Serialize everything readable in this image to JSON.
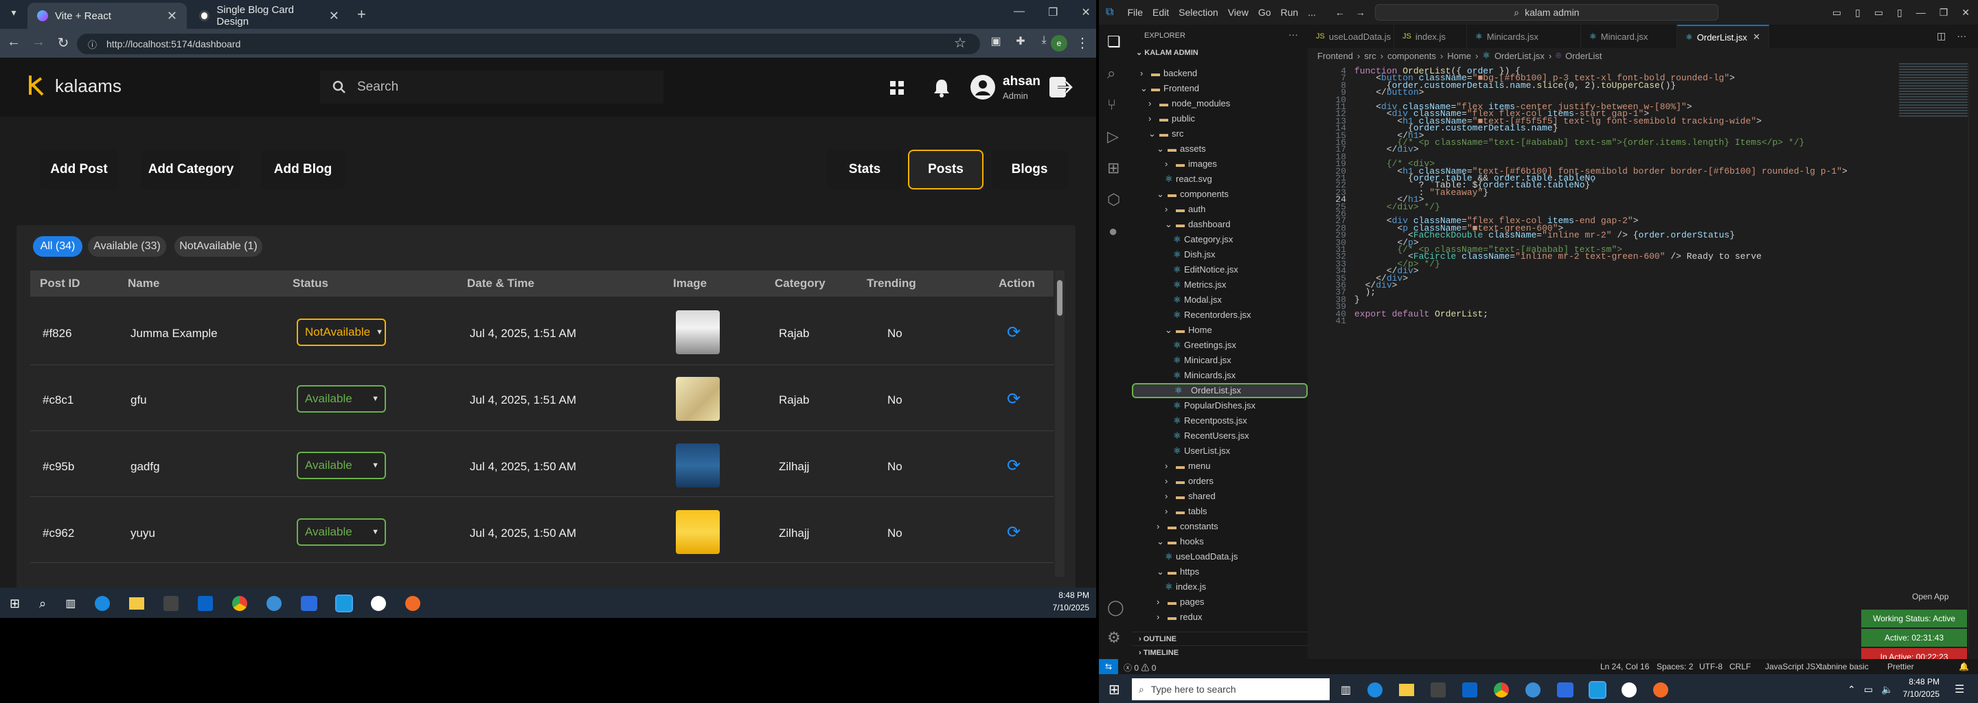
{
  "browser": {
    "tabs": [
      {
        "title": "Vite + React"
      },
      {
        "title": "Single Blog Card Design"
      }
    ],
    "url": "http://localhost:5174/dashboard"
  },
  "app": {
    "logo": "kalaams",
    "search_placeholder": "Search",
    "user": {
      "name": "ahsan",
      "role": "Admin"
    },
    "left_nav": [
      "Add Post",
      "Add Category",
      "Add Blog"
    ],
    "right_nav": [
      "Stats",
      "Posts",
      "Blogs"
    ],
    "active_nav": "Posts",
    "filters": [
      "All (34)",
      "Available (33)",
      "NotAvailable (1)"
    ],
    "columns": [
      "Post ID",
      "Name",
      "Status",
      "Date & Time",
      "Image",
      "Category",
      "Trending",
      "Action"
    ],
    "rows": [
      {
        "id": "#f826",
        "name": "Jumma Example",
        "status": "NotAvailable",
        "date": "Jul 4, 2025, 1:51 AM",
        "category": "Rajab",
        "trending": "No"
      },
      {
        "id": "#c8c1",
        "name": "gfu",
        "status": "Available",
        "date": "Jul 4, 2025, 1:51 AM",
        "category": "Rajab",
        "trending": "No"
      },
      {
        "id": "#c95b",
        "name": "gadfg",
        "status": "Available",
        "date": "Jul 4, 2025, 1:50 AM",
        "category": "Zilhajj",
        "trending": "No"
      },
      {
        "id": "#c962",
        "name": "yuyu",
        "status": "Available",
        "date": "Jul 4, 2025, 1:50 AM",
        "category": "Zilhajj",
        "trending": "No"
      }
    ],
    "colors": {
      "accent": "#f6b100",
      "available": "#6ab04c",
      "not_available": "#f6b100",
      "filter_active": "#1e7ee8",
      "refresh": "#1e90ff"
    }
  },
  "taskbar_left": {
    "time": "8:48 PM",
    "date": "7/10/2025"
  },
  "vscode": {
    "menu": [
      "File",
      "Edit",
      "Selection",
      "View",
      "Go",
      "Run",
      "..."
    ],
    "search": "kalam admin",
    "explorer_title": "EXPLORER",
    "workspace": "KALAM ADMIN",
    "tree": [
      {
        "label": "backend",
        "depth": 0,
        "kind": "folder",
        "open": false
      },
      {
        "label": "Frontend",
        "depth": 0,
        "kind": "folder",
        "open": true
      },
      {
        "label": "node_modules",
        "depth": 1,
        "kind": "folder",
        "open": false
      },
      {
        "label": "public",
        "depth": 1,
        "kind": "folder",
        "open": false
      },
      {
        "label": "src",
        "depth": 1,
        "kind": "folder",
        "open": true
      },
      {
        "label": "assets",
        "depth": 2,
        "kind": "folder",
        "open": true
      },
      {
        "label": "images",
        "depth": 3,
        "kind": "folder",
        "open": false
      },
      {
        "label": "react.svg",
        "depth": 3,
        "kind": "file",
        "open": false
      },
      {
        "label": "components",
        "depth": 2,
        "kind": "folder",
        "open": true
      },
      {
        "label": "auth",
        "depth": 3,
        "kind": "folder",
        "open": false
      },
      {
        "label": "dashboard",
        "depth": 3,
        "kind": "folder",
        "open": true
      },
      {
        "label": "Category.jsx",
        "depth": 4,
        "kind": "file",
        "open": false
      },
      {
        "label": "Dish.jsx",
        "depth": 4,
        "kind": "file",
        "open": false
      },
      {
        "label": "EditNotice.jsx",
        "depth": 4,
        "kind": "file",
        "open": false
      },
      {
        "label": "Metrics.jsx",
        "depth": 4,
        "kind": "file",
        "open": false
      },
      {
        "label": "Modal.jsx",
        "depth": 4,
        "kind": "file",
        "open": false
      },
      {
        "label": "Recentorders.jsx",
        "depth": 4,
        "kind": "file",
        "open": false
      },
      {
        "label": "Home",
        "depth": 3,
        "kind": "folder",
        "open": true
      },
      {
        "label": "Greetings.jsx",
        "depth": 4,
        "kind": "file",
        "open": false
      },
      {
        "label": "Minicard.jsx",
        "depth": 4,
        "kind": "file",
        "open": false
      },
      {
        "label": "Minicards.jsx",
        "depth": 4,
        "kind": "file",
        "open": false
      },
      {
        "label": "OrderList.jsx",
        "depth": 4,
        "kind": "file",
        "open": false
      },
      {
        "label": "PopularDishes.jsx",
        "depth": 4,
        "kind": "file",
        "open": false
      },
      {
        "label": "Recentposts.jsx",
        "depth": 4,
        "kind": "file",
        "open": false
      },
      {
        "label": "RecentUsers.jsx",
        "depth": 4,
        "kind": "file",
        "open": false
      },
      {
        "label": "UserList.jsx",
        "depth": 4,
        "kind": "file",
        "open": false
      },
      {
        "label": "menu",
        "depth": 3,
        "kind": "folder",
        "open": false
      },
      {
        "label": "orders",
        "depth": 3,
        "kind": "folder",
        "open": false
      },
      {
        "label": "shared",
        "depth": 3,
        "kind": "folder",
        "open": false
      },
      {
        "label": "tabls",
        "depth": 3,
        "kind": "folder",
        "open": false
      },
      {
        "label": "constants",
        "depth": 2,
        "kind": "folder",
        "open": false
      },
      {
        "label": "hooks",
        "depth": 2,
        "kind": "folder",
        "open": true
      },
      {
        "label": "useLoadData.js",
        "depth": 3,
        "kind": "file",
        "open": false
      },
      {
        "label": "https",
        "depth": 2,
        "kind": "folder",
        "open": true
      },
      {
        "label": "index.js",
        "depth": 3,
        "kind": "file",
        "open": false
      },
      {
        "label": "pages",
        "depth": 2,
        "kind": "folder",
        "open": false
      },
      {
        "label": "redux",
        "depth": 2,
        "kind": "folder",
        "open": false
      }
    ],
    "selected_file": "OrderList.jsx",
    "outline": "OUTLINE",
    "timeline": "TIMELINE",
    "tabs": [
      "useLoadData.js",
      "index.js",
      "Minicards.jsx",
      "Minicard.jsx",
      "OrderList.jsx"
    ],
    "active_tab": "OrderList.jsx",
    "breadcrumb": [
      "Frontend",
      "src",
      "components",
      "Home",
      "OrderList.jsx",
      "OrderList"
    ],
    "line_numbers": [
      "4",
      "7",
      "8",
      "9",
      "10",
      "11",
      "12",
      "13",
      "14",
      "15",
      "16",
      "17",
      "18",
      "19",
      "20",
      "21",
      "22",
      "23",
      "24",
      "25",
      "26",
      "27",
      "28",
      "29",
      "30",
      "31",
      "32",
      "33",
      "34",
      "35",
      "36",
      "37",
      "38",
      "39",
      "40",
      "41"
    ],
    "code_lines": [
      "function OrderList({ order }) {",
      "    <button className=\"■bg-[#f6b100] p-3 text-xl font-bold rounded-lg\">",
      "      {order.customerDetails.name.slice(0, 2).toUpperCase()}",
      "    </button>",
      "",
      "    <div className=\"flex items-center justify-between w-[80%]\">",
      "      <div className=\"flex flex-col items-start gap-1\">",
      "        <h1 className=\"■text-[#f5f5f5] text-lg font-semibold tracking-wide\">",
      "          {order.customerDetails.name}",
      "        </h1>",
      "        {/* <p className=\"text-[#ababab] text-sm\">{order.items.length} Items</p> */}",
      "      </div>",
      "",
      "      {/* <div>",
      "        <h1 className=\"text-[#f6b100] font-semibold border border-[#f6b100] rounded-lg p-1\">",
      "          {order.table && order.table.tableNo",
      "            ? `Table: ${order.table.tableNo}`",
      "            : \"Takeaway\"}",
      "        </h1>",
      "      </div> */}",
      "",
      "      <div className=\"flex flex-col items-end gap-2\">",
      "        <p className=\"■text-green-600\">",
      "          <FaCheckDouble className=\"inline mr-2\" /> {order.orderStatus}",
      "        </p>",
      "        {/* <p className=\"text-[#ababab] text-sm\">",
      "          <FaCircle className=\"inline mr-2 text-green-600\" /> Ready to serve",
      "        </p> */}",
      "      </div>",
      "    </div>",
      "  </div>",
      "  );",
      "}",
      "",
      "export default OrderList;",
      ""
    ],
    "status": {
      "errors": "0",
      "warnings": "0",
      "position": "Ln 24, Col 16",
      "spaces": "Spaces: 2",
      "encoding": "UTF-8",
      "eol": "CRLF",
      "language": "JavaScript JSX",
      "extension": "tabnine basic",
      "prettier": "Prettier"
    },
    "open_app": "Open App",
    "working_status": "Working Status: Active",
    "active_time": "Active: 02:31:43",
    "inactive_time": "In Active: 00:22:23"
  },
  "taskbar_right": {
    "search_placeholder": "Type here to search",
    "time": "8:48 PM",
    "date": "7/10/2025"
  }
}
